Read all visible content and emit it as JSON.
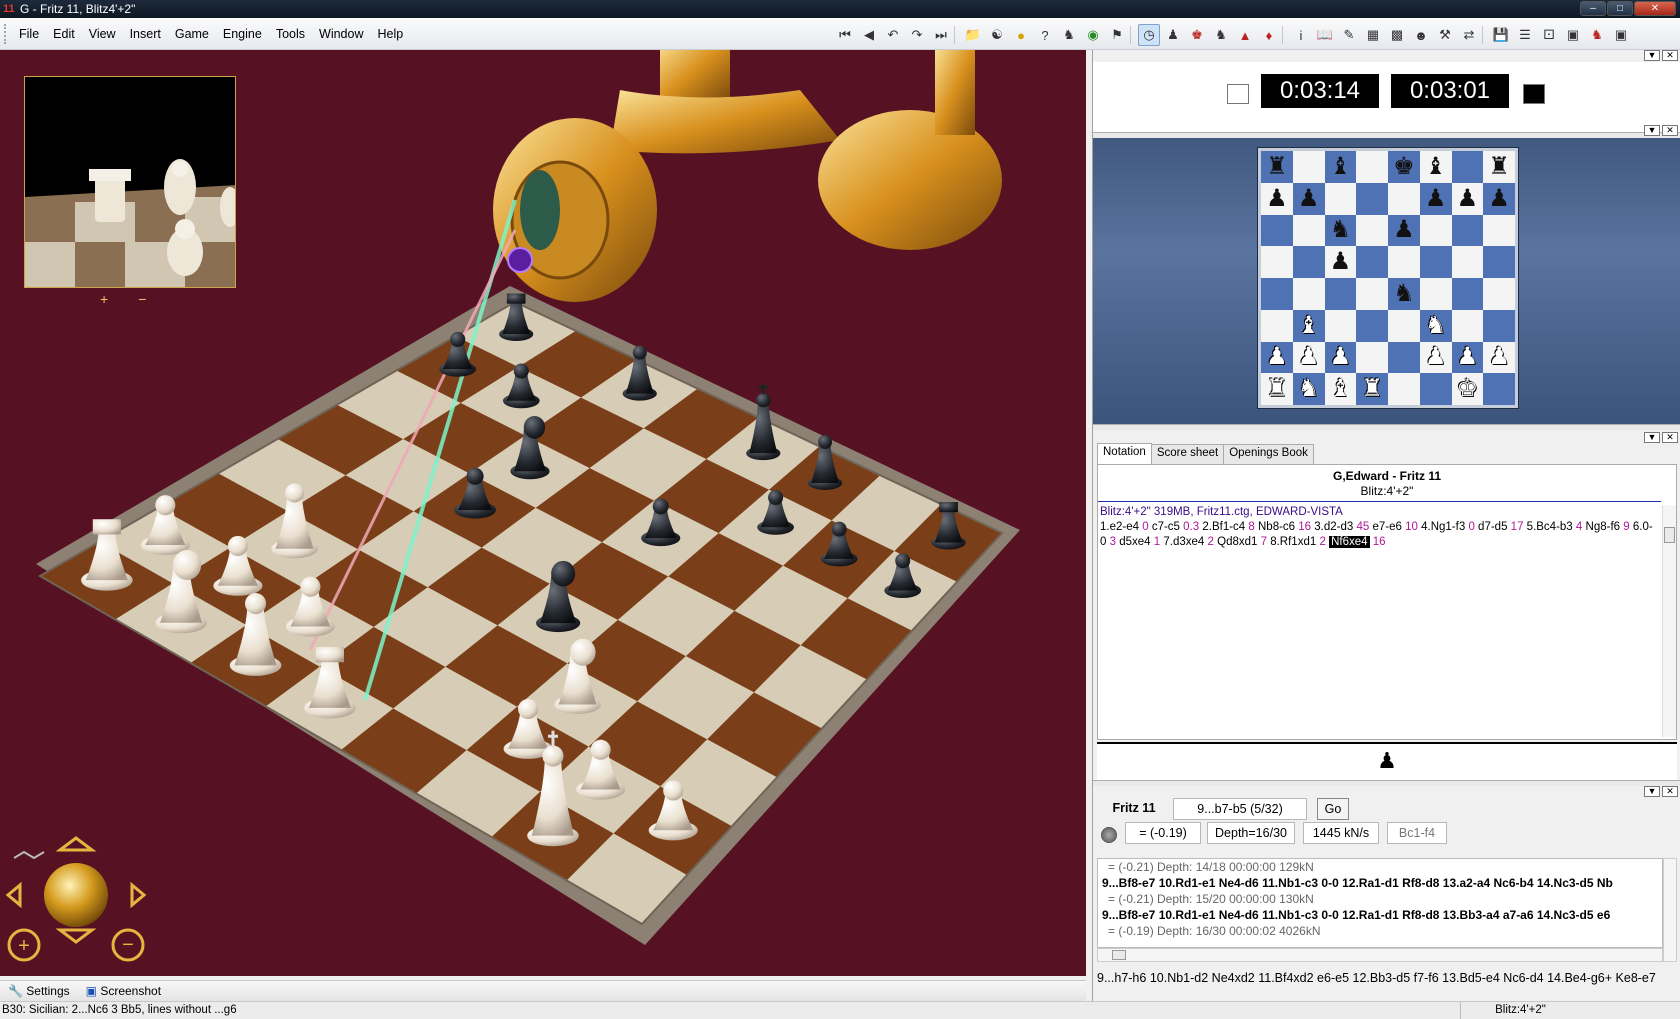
{
  "window": {
    "title": "G - Fritz 11, Blitz4'+2\"",
    "app_icon": "11"
  },
  "menu": [
    "File",
    "Edit",
    "View",
    "Insert",
    "Game",
    "Engine",
    "Tools",
    "Window",
    "Help"
  ],
  "toolbar_icons": [
    "first-move-icon",
    "back-move-icon",
    "back-variation-icon",
    "forward-variation-icon",
    "last-move-icon",
    "new-game-icon",
    "opponent-icon",
    "hint-icon",
    "help-icon",
    "engine-icon",
    "book-icon",
    "flag-icon",
    "clock-icon",
    "pawn-icon",
    "analysis-icon",
    "trainer-icon",
    "level-icon",
    "tournament-icon",
    "info-icon",
    "openings-icon",
    "pen-icon",
    "layout-icon",
    "board-icon",
    "user-icon",
    "tools-icon",
    "network-icon",
    "save-icon",
    "list-icon",
    "dice-icon",
    "cube-icon",
    "pieces-icon",
    "screenshot-icon"
  ],
  "thumb_controls": {
    "plus": "+",
    "minus": "−"
  },
  "bottom_bar": {
    "settings": "Settings",
    "screenshot": "Screenshot"
  },
  "status": {
    "opening": "B30: Sicilian: 2...Nc6 3 Bb5, lines without ...g6",
    "time_control": "Blitz:4'+2\""
  },
  "clocks": {
    "white": "0:03:14",
    "black": "0:03:01"
  },
  "board": {
    "rows": [
      [
        "r",
        "",
        "b",
        "",
        "k",
        "b",
        "",
        "r"
      ],
      [
        "p",
        "p",
        "",
        "",
        "",
        "p",
        "p",
        "p"
      ],
      [
        "",
        "",
        "n",
        "",
        "p",
        "",
        "",
        ""
      ],
      [
        "",
        "",
        "p",
        "",
        "",
        "",
        "",
        ""
      ],
      [
        "",
        "",
        "",
        "",
        "n",
        "",
        "",
        ""
      ],
      [
        "",
        "B",
        "",
        "",
        "",
        "N",
        "",
        ""
      ],
      [
        "P",
        "P",
        "P",
        "",
        "",
        "P",
        "P",
        "P"
      ],
      [
        "R",
        "N",
        "B",
        "R",
        "",
        "",
        "K",
        ""
      ]
    ]
  },
  "notation_tabs": [
    "Notation",
    "Score sheet",
    "Openings Book"
  ],
  "game": {
    "players": "G,Edward - Fritz 11",
    "event": "Blitz:4'+2\"",
    "header_line": "Blitz:4'+2\"   319MB, Fritz11.ctg, EDWARD-VISTA",
    "moves": [
      {
        "m": "1.e2-e4",
        "t": "0"
      },
      {
        "m": "c7-c5",
        "t": "0.3"
      },
      {
        "m": "2.Bf1-c4",
        "t": "8"
      },
      {
        "m": "Nb8-c6",
        "t": "16"
      },
      {
        "m": "3.d2-d3",
        "t": "45"
      },
      {
        "m": "e7-e6",
        "t": "10"
      },
      {
        "m": "4.Ng1-f3",
        "t": "0"
      },
      {
        "m": "d7-d5",
        "t": "17"
      },
      {
        "m": "5.Bc4-b3",
        "t": "4"
      },
      {
        "m": "Ng8-f6",
        "t": "9"
      },
      {
        "m": "6.0-0",
        "t": "3"
      },
      {
        "m": "d5xe4",
        "t": "1"
      },
      {
        "m": "7.d3xe4",
        "t": "2"
      },
      {
        "m": "Qd8xd1",
        "t": "7"
      },
      {
        "m": "8.Rf1xd1",
        "t": "2"
      },
      {
        "m": "Nf6xe4",
        "t": "16",
        "current": true
      }
    ],
    "side_to_move_icon": "♟"
  },
  "engine": {
    "name": "Fritz 11",
    "current_move": "9...b7-b5 (5/32)",
    "go": "Go",
    "eval": "= (-0.19)",
    "depth": "Depth=16/30",
    "speed": "1445 kN/s",
    "best": "Bc1-f4",
    "lines": [
      {
        "type": "score",
        "text": "= (-0.21)   Depth: 14/18   00:00:00  129kN"
      },
      {
        "type": "line",
        "text": "9...Bf8-e7 10.Rd1-e1 Ne4-d6 11.Nb1-c3 0-0 12.Ra1-d1 Rf8-d8 13.a2-a4 Nc6-b4 14.Nc3-d5 Nb"
      },
      {
        "type": "score",
        "text": "= (-0.21)   Depth: 15/20   00:00:00  130kN"
      },
      {
        "type": "line",
        "text": "9...Bf8-e7 10.Rd1-e1 Ne4-d6 11.Nb1-c3 0-0 12.Ra1-d1 Rf8-d8 13.Bb3-a4 a7-a6 14.Nc3-d5 e6"
      },
      {
        "type": "score",
        "text": "= (-0.19)   Depth: 16/30   00:00:02  4026kN"
      }
    ],
    "main_line": "9...h7-h6 10.Nb1-d2 Ne4xd2 11.Bf4xd2 e6-e5 12.Bb3-d5 f7-f6 13.Bd5-e4 Nc6-d4 14.Be4-g6+ Ke8-e7"
  }
}
